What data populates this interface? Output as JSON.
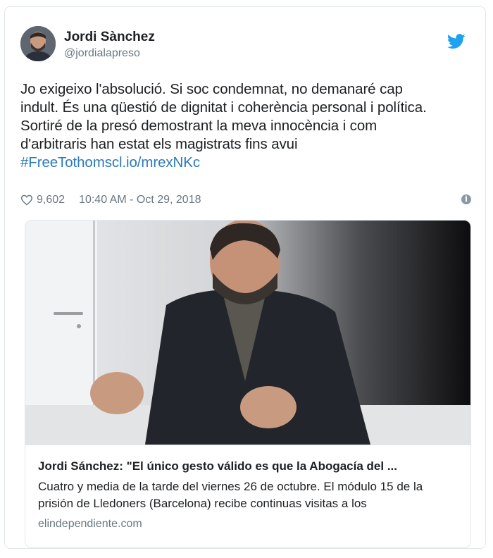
{
  "author": {
    "name": "Jordi Sànchez",
    "handle": "@jordialapreso",
    "avatar_icon": "avatar-photo"
  },
  "tweet": {
    "text": "Jo exigeixo l'absolució. Si soc condemnat, no demanaré cap\nindult. És una qüestió de dignitat i coherència personal i política.\nSortiré de la presó demostrant la meva innocència i com\nd'arbitraris han estat els magistrats fins avui\n",
    "hashtag": "#FreeTothom",
    "link": "scl.io/mrexNKc",
    "likes": "9,602",
    "timestamp": "10:40 AM - Oct 29, 2018",
    "info_icon": "i"
  },
  "card": {
    "title": "Jordi Sánchez: \"El único gesto válido es que la Abogacía del ...",
    "description": "Cuatro y media de la tarde del viernes 26 de octubre. El módulo 15 de la prisión de Lledoners (Barcelona) recibe continuas visitas a los",
    "domain": "elindependiente.com"
  },
  "colors": {
    "twitter_blue": "#1da1f2",
    "link": "#2b7bb9",
    "secondary_text": "#697882",
    "border": "#e1e8ed"
  }
}
